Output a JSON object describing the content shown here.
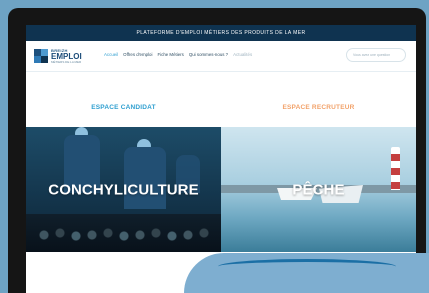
{
  "top_banner": "PLATEFORME D'EMPLOI MÉTIERS DES PRODUITS DE LA MER",
  "logo": {
    "top": "BREIZH",
    "main": "EMPLOI",
    "sub": "MÉTIERS DE LA MER"
  },
  "nav": {
    "accueil": "Accueil",
    "offres": "Offres d'emploi",
    "fiches": "Fiche Métiers",
    "qui": "Qui sommes-nous ?",
    "actualites": "Actualités"
  },
  "search_placeholder": "Vous avez une question",
  "sections": {
    "candidat": "ESPACE CANDIDAT",
    "recruteur": "ESPACE RECRUTEUR"
  },
  "panels": {
    "left_label": "CONCHYLICULTURE",
    "right_label": "PÊCHE"
  }
}
